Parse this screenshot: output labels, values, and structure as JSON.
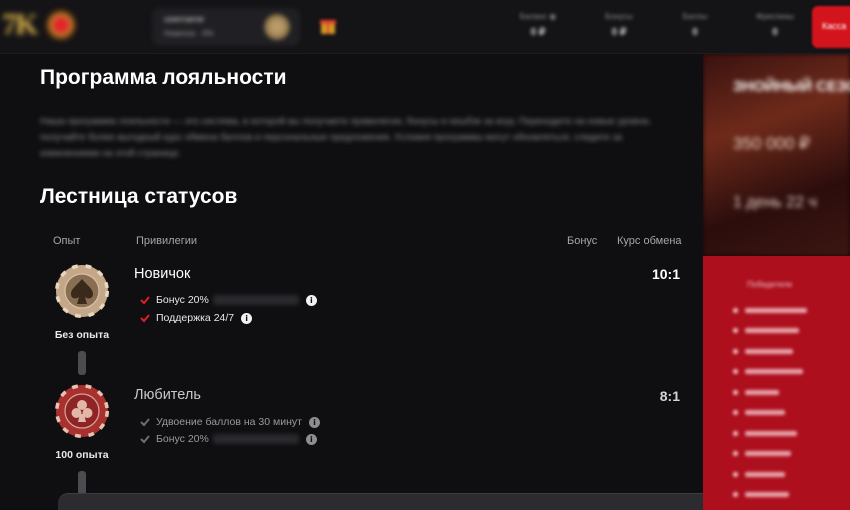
{
  "header": {
    "logo_text": "7K",
    "user": {
      "name": "username",
      "level": "Новичок · 0%"
    },
    "stats": [
      {
        "label": "Баланс ◉",
        "value": "0 ₽"
      },
      {
        "label": "Бонусы",
        "value": "0 ₽"
      },
      {
        "label": "Баллы",
        "value": "0"
      },
      {
        "label": "Фриспины",
        "value": "0"
      }
    ],
    "action_label": "Касса"
  },
  "main": {
    "title": "Программа лояльности",
    "intro": "Наша программа лояльности — это система, в которой вы получаете привилегии, бонусы и кешбэк за игру. Переходите на новые уровни, получайте более выгодный курс обмена баллов и персональные предложения. Условия программы могут обновляться, следите за изменениями на этой странице.",
    "ladder_title": "Лестница статусов",
    "columns": {
      "experience": "Опыт",
      "privileges": "Привилегии",
      "bonus": "Бонус",
      "rate": "Курс обмена"
    },
    "tiers": [
      {
        "name": "Новичок",
        "experience": "Без опыта",
        "rate": "10:1",
        "badge_color": "#b89a7a",
        "perks": [
          "Бонус 20%",
          "Поддержка 24/7"
        ]
      },
      {
        "name": "Любитель",
        "experience": "100 опыта",
        "rate": "8:1",
        "badge_color": "#a82d2f",
        "perks": [
          "Удвоение баллов на 30 минут",
          "Бонус 20%"
        ]
      }
    ]
  },
  "promo": {
    "title": "ЗНОЙНЫЙ СЕЗОН",
    "amount": "350 000 ₽",
    "timer": "1 день 22 ч",
    "list_title": "Победители",
    "list_count": 10
  },
  "colors": {
    "accent": "#d4141c",
    "check_active": "#e01e2a",
    "check_inactive": "#6e6e72",
    "promo_red": "#ad0f1d"
  }
}
